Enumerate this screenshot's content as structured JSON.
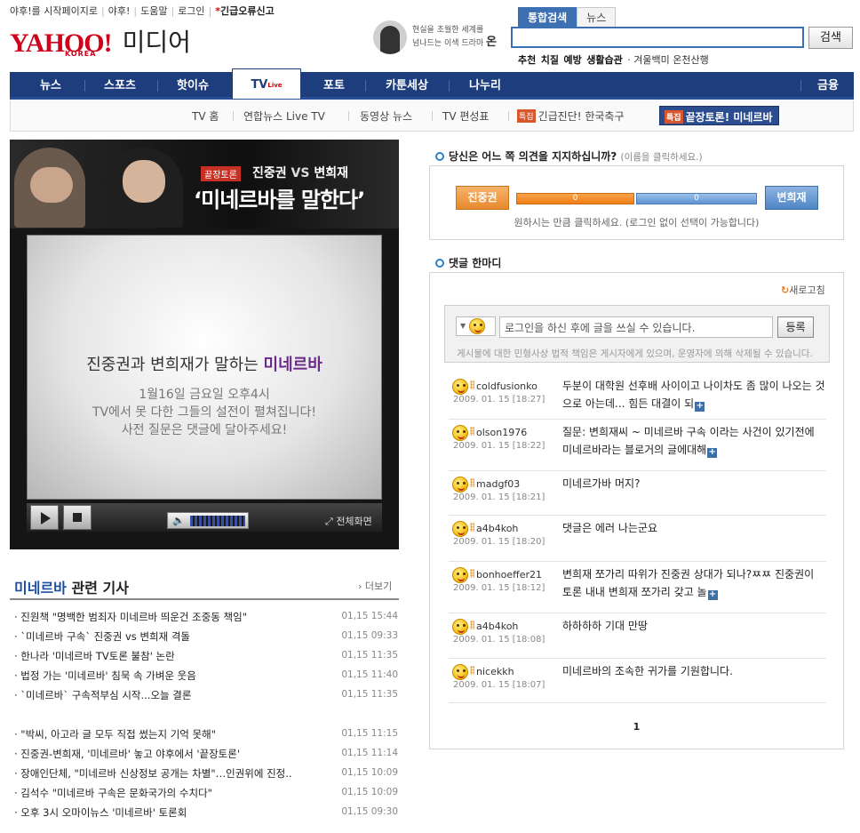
{
  "top_links": {
    "start_page": "야후!를 시작페이지로",
    "yahoo": "야후!",
    "help": "도움말",
    "login": "로그인",
    "urgent_report": "긴급오류신고"
  },
  "logo": {
    "brand": "YAHOO!",
    "region": "KOREA",
    "section": "미디어"
  },
  "ad": {
    "line1": "현실을 초월한 세계를",
    "line2": "넘나드는 이색 드라마",
    "highlight": "온"
  },
  "search": {
    "tabs": [
      "통합검색",
      "뉴스"
    ],
    "query": "",
    "button": "검색",
    "recommend_label": "추천",
    "recommend_bold": [
      "치질",
      "예방",
      "생활습관"
    ],
    "recommend_rest": "겨울백미 온천산행"
  },
  "nav": {
    "items": [
      "뉴스",
      "스포츠",
      "핫이슈",
      "TV",
      "포토",
      "카툰세상",
      "나누리"
    ],
    "tv_live": "Live",
    "right": "금융"
  },
  "subnav": {
    "items": [
      "TV 홈",
      "연합뉴스 Live TV",
      "동영상 뉴스",
      "TV 편성표"
    ],
    "special_tag": "특집",
    "special1": "긴급진단! 한국축구",
    "special2": "끝장토론! 미네르바"
  },
  "video": {
    "tag": "끝장토론",
    "title_a": "진중권",
    "title_vs": "VS",
    "title_b": "변희재",
    "headline": "‘미네르바를 말한다’",
    "screen_prefix": "진중권과 변희재가 말하는",
    "screen_highlight": "미네르바",
    "screen_lines": [
      "1월16일 금요일 오후4시",
      "TV에서 못 다한 그들의 설전이 펼쳐집니다!",
      "사전 질문은 댓글에 달아주세요!"
    ],
    "fullscreen": "전체화면",
    "volume_icon": "speaker-icon"
  },
  "related": {
    "title_highlight": "미네르바",
    "title_rest": "관련 기사",
    "more": "더보기",
    "items": [
      {
        "title": "· 진원책 \"명백한 범죄자 미네르바 띄운건 조중동 책임\"",
        "time": "01,15 15:44"
      },
      {
        "title": "· `미네르바 구속` 진중권 vs 변희재 격돌",
        "time": "01,15 09:33"
      },
      {
        "title": "· 한나라 '미네르바 TV토론 불참' 논란",
        "time": "01,15 11:35"
      },
      {
        "title": "· 법정 가는 '미네르바' 침묵 속 가벼운 웃음",
        "time": "01,15 11:40"
      },
      {
        "title": "· `미네르바` 구속적부심 시작...오늘 결론",
        "time": "01,15 11:35"
      },
      {
        "title": "· \"박씨, 아고라 글 모두 직접 썼는지 기억 못해\"",
        "time": "01,15 11:15"
      },
      {
        "title": "· 진중권-변희재, '미네르바' 놓고 야후에서 '끝장토론'",
        "time": "01,15 11:14"
      },
      {
        "title": "· 장애인단체, \"미네르바 신상정보 공개는 차별\"…인권위에 진정..",
        "time": "01,15 10:09"
      },
      {
        "title": "· 김석수 \"미네르바 구속은 문화국가의 수치다\"",
        "time": "01,15 10:09"
      },
      {
        "title": "· 오후 3시 오마이뉴스 '미네르바' 토론회",
        "time": "01,15 09:30"
      }
    ]
  },
  "poll": {
    "title": "당신은 어느 쪽 의견을 지지하십니까?",
    "hint": "(이름을 클릭하세요.)",
    "option_a": "진중권",
    "option_b": "변희재",
    "votes_a": "0",
    "votes_b": "0",
    "note": "원하시는 만큼 클릭하세요. (로그인 없이 선택이 가능합니다)",
    "colors": {
      "a": "#f07d17",
      "b": "#5e93d3"
    }
  },
  "comments": {
    "title": "댓글 한마디",
    "refresh": "새로고침",
    "input_placeholder": "로그인을 하신 후에 글을 쓰실 수 있습니다.",
    "submit": "등록",
    "notice": "게시물에 대한 민형사상 법적 책임은 게시자에게 있으며, 운영자에 의해 삭제될 수 있습니다.",
    "items": [
      {
        "user": "coldfusionko",
        "date": "2009. 01. 15 [18:27]",
        "text": "두분이 대학원 선후배 사이이고 나이차도 좀 많이 나오는 것으로 아는데... 힘든 대결이 되",
        "more": true
      },
      {
        "user": "olson1976",
        "date": "2009. 01. 15 [18:22]",
        "text": "질문: 변희재씨 ~ 미네르바 구속 이라는 사건이 있기전에 미네르바라는 블로거의 글에대해",
        "more": true
      },
      {
        "user": "madgf03",
        "date": "2009. 01. 15 [18:21]",
        "text": "미네르가바 머지?",
        "more": false
      },
      {
        "user": "a4b4koh",
        "date": "2009. 01. 15 [18:20]",
        "text": "댓글은 에러 나는군요",
        "more": false
      },
      {
        "user": "bonhoeffer21",
        "date": "2009. 01. 15 [18:12]",
        "text": "변희재 쪼가리 따위가 진중권 상대가 되나?ㅉㅉ 진중권이 토론 내내 변희재 쪼가리 갖고 놀",
        "more": true
      },
      {
        "user": "a4b4koh",
        "date": "2009. 01. 15 [18:08]",
        "text": "하하하하 기대 만땅",
        "more": false
      },
      {
        "user": "nicekkh",
        "date": "2009. 01. 15 [18:07]",
        "text": "미네르바의 조속한 귀가를 기원합니다.",
        "more": false
      }
    ],
    "page": "1"
  }
}
